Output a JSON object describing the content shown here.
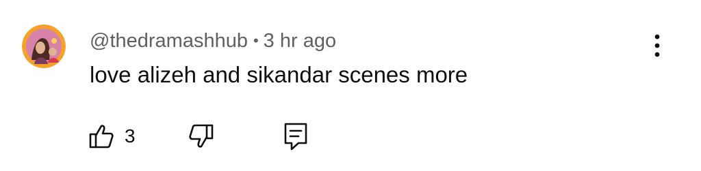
{
  "comment": {
    "author": "@thedramashhub",
    "separator": "•",
    "timestamp": "3 hr ago",
    "text": "love alizeh and sikandar scenes more",
    "like_count": "3"
  },
  "icons": {
    "like": "thumbs-up-icon",
    "dislike": "thumbs-down-icon",
    "reply": "comment-reply-icon",
    "more": "more-vertical-icon"
  },
  "colors": {
    "text_primary": "#0f0f0f",
    "text_secondary": "#606060",
    "avatar_ring": "#f5a623"
  }
}
